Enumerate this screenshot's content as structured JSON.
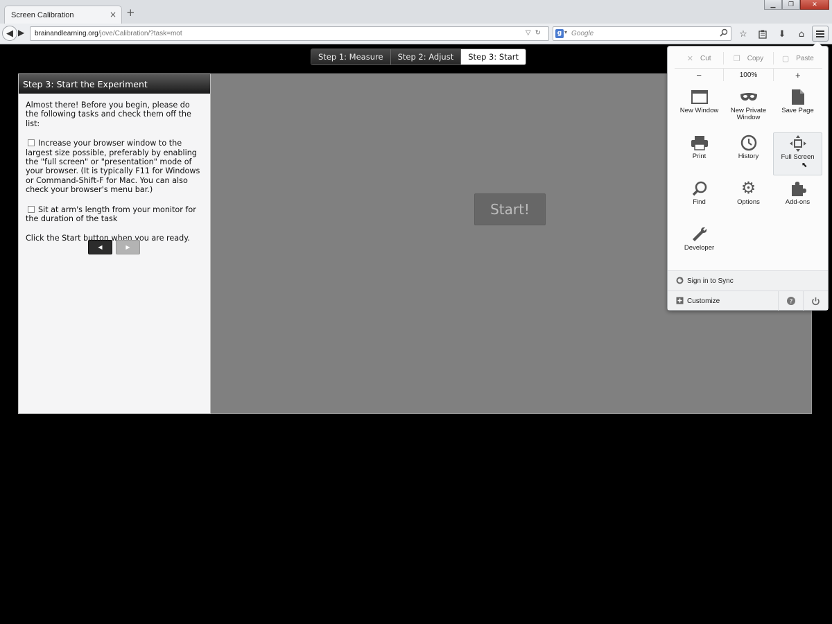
{
  "browser": {
    "tab_title": "Screen Calibration",
    "tab_close": "×",
    "new_tab": "+",
    "url_host": "brainandlearning.org",
    "url_path": "/jove/Calibration/?task=mot",
    "search_placeholder": "Google",
    "search_engine_badge": "g"
  },
  "steps": [
    {
      "label": "Step 1: Measure",
      "active": false
    },
    {
      "label": "Step 2: Adjust",
      "active": false
    },
    {
      "label": "Step 3: Start",
      "active": true
    }
  ],
  "panel": {
    "heading": "Step 3: Start the Experiment",
    "intro": "Almost there! Before you begin, please do the following tasks and check them off the list:",
    "tasks": [
      {
        "text": "Increase your browser window to the largest size possible, preferably by enabling the \"full screen\" or \"presentation\" mode of your browser. (It is typically F11 for Windows or Command-Shift-F for Mac. You can also check your browser's menu bar.)",
        "checked": false
      },
      {
        "text": "Sit at arm's length from your monitor for the duration of the task",
        "checked": false
      }
    ],
    "outro": "Click the Start button when you are ready."
  },
  "stage": {
    "start_label": "Start!"
  },
  "menu": {
    "edit": {
      "cut": "Cut",
      "copy": "Copy",
      "paste": "Paste"
    },
    "zoom": {
      "minus": "−",
      "level": "100%",
      "plus": "+"
    },
    "items": [
      {
        "label": "New Window",
        "icon": "new-window-icon"
      },
      {
        "label": "New Private Window",
        "icon": "private-window-icon"
      },
      {
        "label": "Save Page",
        "icon": "save-page-icon"
      },
      {
        "label": "Print",
        "icon": "print-icon"
      },
      {
        "label": "History",
        "icon": "history-icon"
      },
      {
        "label": "Full Screen",
        "icon": "full-screen-icon"
      },
      {
        "label": "Find",
        "icon": "find-icon"
      },
      {
        "label": "Options",
        "icon": "options-icon"
      },
      {
        "label": "Add-ons",
        "icon": "add-ons-icon"
      },
      {
        "label": "Developer",
        "icon": "developer-icon"
      }
    ],
    "sign_in": "Sign in to Sync",
    "customize": "Customize",
    "hovered_item": "Full Screen"
  },
  "colors": {
    "page_background": "#000000",
    "stage_background": "#808080",
    "start_button": "#676767",
    "panel_background": "#f5f5f6"
  }
}
